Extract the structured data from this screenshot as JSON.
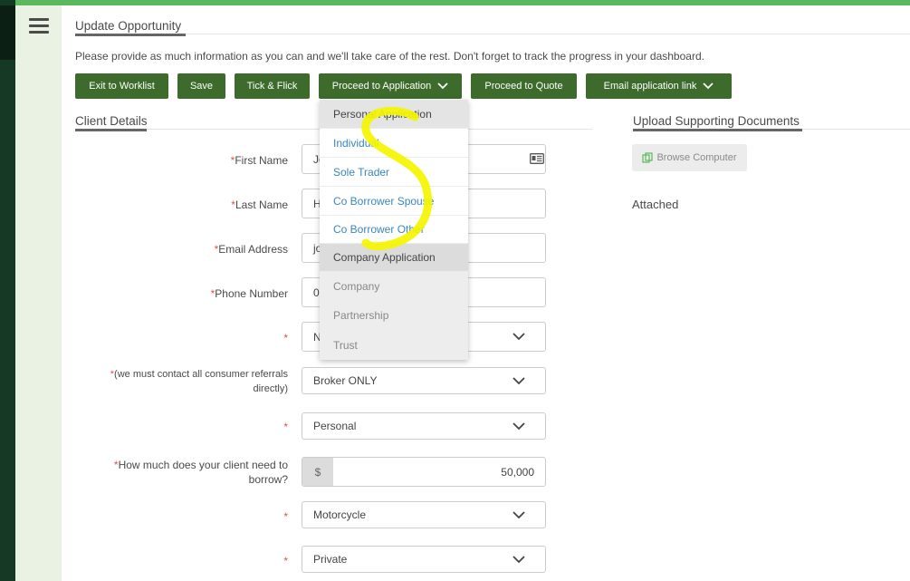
{
  "header": {
    "title": "Update Opportunity",
    "intro": "Please provide as much information as you can and we'll take care of the rest. Don't forget to track the progress in your dashboard."
  },
  "toolbar": {
    "exit": "Exit to Worklist",
    "save": "Save",
    "tick_flick": "Tick & Flick",
    "proceed_application": "Proceed to Application",
    "proceed_quote": "Proceed to Quote",
    "email_link": "Email application link"
  },
  "dropdown": {
    "personal_header": "Personal Application",
    "individual": "Individual",
    "sole_trader": "Sole Trader",
    "co_borrower_spouse": "Co Borrower Spouse",
    "co_borrower_other": "Co Borrower Other",
    "company_header": "Company Application",
    "company": "Company",
    "partnership": "Partnership",
    "trust": "Trust"
  },
  "client": {
    "title": "Client Details",
    "req_mark": "*",
    "first_name_label": "First Name",
    "first_name_value": "Jo",
    "last_name_label": "Last Name",
    "last_name_value": "H",
    "email_label": "Email Address",
    "email_value": "jo",
    "phone_label": "Phone Number",
    "phone_value": "0",
    "select1_value": "N",
    "referral_label": "(we must contact all consumer referrals directly)",
    "referral_value": "Broker ONLY",
    "purpose_value": "Personal",
    "borrow_label": "How much does your client need to borrow?",
    "currency": "$",
    "amount": "50,000",
    "asset_value": "Motorcycle",
    "sale_value": "Private"
  },
  "upload": {
    "title": "Upload Supporting Documents",
    "browse": "Browse Computer",
    "attached": "Attached"
  },
  "icons": {
    "menu": "hamburger-icon",
    "chevron": "chevron-down-icon",
    "id_card": "id-card-icon",
    "copy": "copy-icon"
  },
  "colors": {
    "button": "#3d6b2c",
    "accent_top": "#5cb85c",
    "link": "#3a87c0",
    "required": "#d9534f",
    "highlight": "#f5f500"
  }
}
